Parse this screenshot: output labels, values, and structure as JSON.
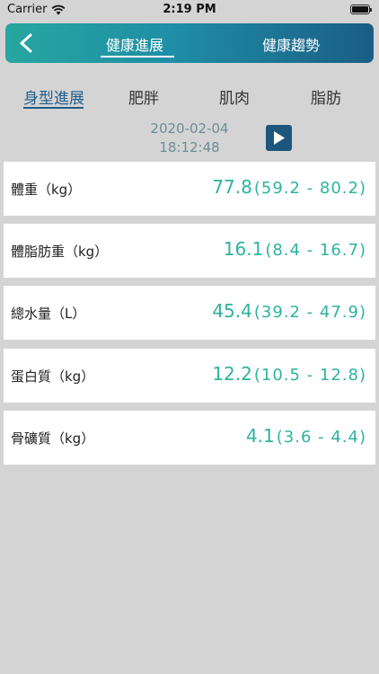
{
  "status_bar": {
    "carrier": "Carrier",
    "time": "2:19 PM"
  },
  "header": {
    "tabs": [
      {
        "label": "健康進展",
        "active": true
      },
      {
        "label": "健康趨勢",
        "active": false
      }
    ]
  },
  "sub_tabs": [
    {
      "label": "身型進展",
      "active": true
    },
    {
      "label": "肥胖",
      "active": false
    },
    {
      "label": "肌肉",
      "active": false
    },
    {
      "label": "脂肪",
      "active": false
    }
  ],
  "datetime": {
    "date": "2020-02-04",
    "time": "18:12:48"
  },
  "metrics": [
    {
      "label": "體重（kg）",
      "value": "77.8",
      "range": "(59.2 - 80.2)"
    },
    {
      "label": "體脂肪重（kg）",
      "value": "16.1",
      "range": "(8.4 - 16.7)"
    },
    {
      "label": "總水量（L）",
      "value": "45.4",
      "range": "(39.2 - 47.9)"
    },
    {
      "label": "蛋白質（kg）",
      "value": "12.2",
      "range": "(10.5 - 12.8)"
    },
    {
      "label": "骨礦質（kg）",
      "value": "4.1",
      "range": "(3.6 - 4.4)"
    }
  ],
  "colors": {
    "accent": "#2db39f",
    "header_start": "#26a6a0",
    "header_end": "#1a5d85",
    "active_tab": "#1f5d8c"
  },
  "icons": {
    "back": "chevron-left-icon",
    "play": "play-icon",
    "wifi": "wifi-icon",
    "battery": "battery-icon"
  }
}
